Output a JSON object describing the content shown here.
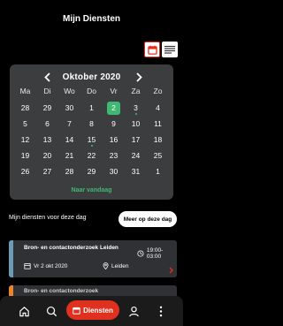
{
  "header": {
    "title": "Mijn Diensten"
  },
  "view_toggle": {
    "calendar_icon": "calendar-icon",
    "list_icon": "list-icon",
    "active": "calendar"
  },
  "calendar": {
    "month_label": "Oktober  2020",
    "weekdays": [
      "Ma",
      "Di",
      "Wo",
      "Do",
      "Vr",
      "Za",
      "Zo"
    ],
    "weeks": [
      [
        "28",
        "29",
        "30",
        "1",
        "2",
        "3",
        "4"
      ],
      [
        "5",
        "6",
        "7",
        "8",
        "9",
        "10",
        "11"
      ],
      [
        "12",
        "13",
        "14",
        "15",
        "16",
        "17",
        "18"
      ],
      [
        "19",
        "20",
        "21",
        "22",
        "23",
        "24",
        "25"
      ],
      [
        "26",
        "27",
        "28",
        "29",
        "30",
        "31",
        "1"
      ]
    ],
    "selected_day": "2",
    "marked_days": [
      "3",
      "15"
    ],
    "today_link": "Naar vandaag",
    "accent_color": "#3fb874"
  },
  "section": {
    "label": "Mijn diensten voor deze dag",
    "more_button": "Meer op deze dag"
  },
  "shifts": [
    {
      "title": "Bron- en contactonderzoek Leiden",
      "time": "19:00-03:00",
      "date": "Vr 2 okt 2020",
      "location": "Leiden",
      "bar_color": "#6b9bb5"
    },
    {
      "title": "Bron- en contactonderzoek",
      "bar_color": "#e8852b"
    }
  ],
  "bottom_nav": {
    "active_label": "Diensten",
    "active_color": "#e0301e",
    "items": [
      "home-icon",
      "search-icon",
      "calendar-icon",
      "profile-icon",
      "more-icon"
    ]
  }
}
